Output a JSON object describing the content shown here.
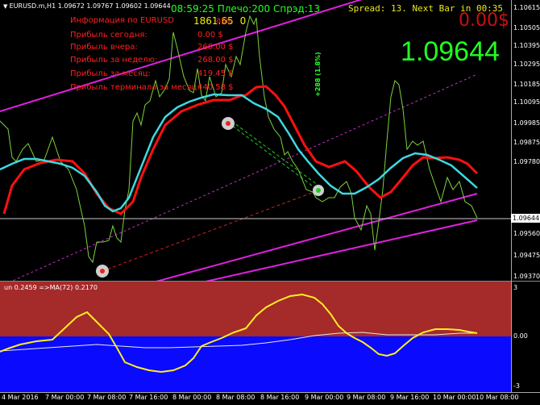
{
  "header": {
    "symbol_info": "EURUSD.m,H1  1.09672 1.09767 1.09602 1.09644",
    "time_leverage_spread": "08:59:25 Плечо:200 Спрэд:13",
    "spread_next_bar": "Spread: 13. Next Bar in 00:35",
    "profit_big": "0.00$",
    "balance": "1861.65",
    "balance_tail": "0",
    "big_price": "1.09644"
  },
  "info_panel": {
    "rows": [
      {
        "label": "Информация по EURUSD",
        "tail": "ары",
        "value": ""
      },
      {
        "label": "Прибыль сегодня:",
        "value": "0.00 $"
      },
      {
        "label": "Прибыль вчера:",
        "value": "268.00 $"
      },
      {
        "label": "Прибыль за неделю:",
        "value": "268.00 $"
      },
      {
        "label": "Прибыль за месяц:",
        "value": "419.45 $"
      },
      {
        "label": "Прибыль терминала за месяц:",
        "value": "440.58 $"
      }
    ]
  },
  "trade_label": "+288 (1.8%)",
  "price_axis": {
    "labels": [
      "1.10615",
      "1.10505",
      "1.10395",
      "1.10295",
      "1.10185",
      "1.10095",
      "1.09985",
      "1.09875",
      "1.09780",
      "1.09644",
      "1.09560",
      "1.09475",
      "1.09370"
    ],
    "current_price": "1.09644"
  },
  "indicator": {
    "label": "un 0.2459  =>MA(72) 0.2170",
    "axis": [
      "3",
      "0.00",
      "-3"
    ]
  },
  "time_axis": [
    "4 Mar 2016",
    "7 Mar 00:00",
    "7 Mar 08:00",
    "7 Mar 16:00",
    "8 Mar 00:00",
    "8 Mar 08:00",
    "8 Mar 16:00",
    "9 Mar 00:00",
    "9 Mar 08:00",
    "9 Mar 16:00",
    "10 Mar 00:00",
    "10 Mar 08:00"
  ],
  "colors": {
    "price_line": "#7cd23c",
    "red_ma": "#ff1010",
    "cyan_ma": "#3fd8e0",
    "channel": "#e020e0",
    "osc_line": "#ffee22",
    "osc_ma": "#e8e8e8",
    "zone_upper": "#a52a2a",
    "zone_lower": "#0a0aff",
    "text_green": "#22ff22",
    "text_red": "#ff2020",
    "spread_text": "#e8e820"
  }
}
